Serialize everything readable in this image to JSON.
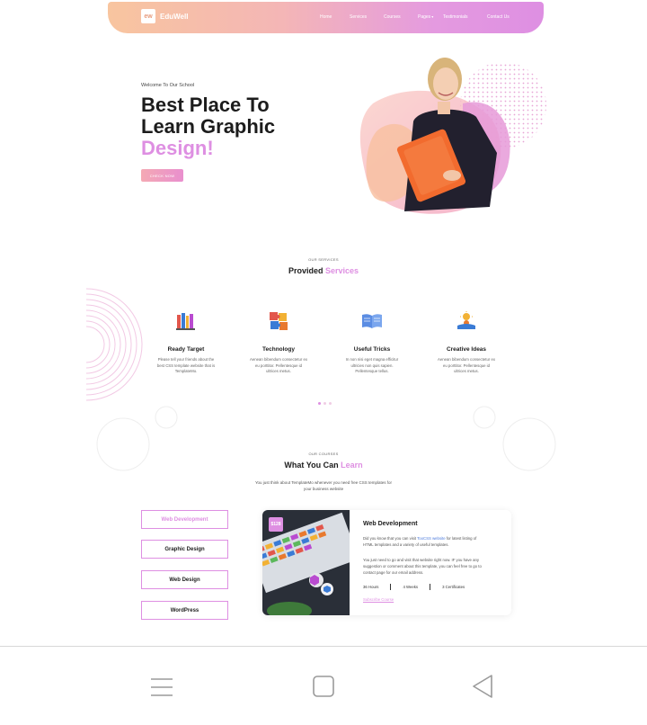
{
  "header": {
    "logo_mark": "ew",
    "logo_text": "EduWell",
    "nav": [
      "Home",
      "Services",
      "Courses",
      "Pages",
      "Testimonials",
      "Contact Us"
    ]
  },
  "hero": {
    "welcome": "Welcome To Our School",
    "title_line1": "Best Place To",
    "title_line2": "Learn Graphic",
    "title_accent": "Design!",
    "button": "CHECK NOW"
  },
  "services": {
    "kicker": "OUR SERVICES",
    "title_plain": "Provided ",
    "title_accent": "Services",
    "items": [
      {
        "icon": "books-icon",
        "title": "Ready Target",
        "lines": [
          "Please tell your friends about the",
          "best CSS template website that is",
          "TemplateMo."
        ]
      },
      {
        "icon": "puzzle-icon",
        "title": "Technology",
        "lines": [
          "Aenean bibendum consectetur ex",
          "eu porttitor. Pellentesque id",
          "ultrices metus."
        ]
      },
      {
        "icon": "open-book-icon",
        "title": "Useful Tricks",
        "lines": [
          "In non nisi eget magna efficitur",
          "ultricies non quis sapien.",
          "Pellentesque tellus."
        ]
      },
      {
        "icon": "reading-idea-icon",
        "title": "Creative Ideas",
        "lines": [
          "Aenean bibendum consectetur ex",
          "eu porttitor. Pellentesque id",
          "ultrices metus."
        ]
      }
    ],
    "carousel_active": 0
  },
  "courses": {
    "kicker": "OUR COURSES",
    "title_plain": "What You Can ",
    "title_accent": "Learn",
    "desc_line1": "You just think about TemplateMo whenever you need free CSS templates for",
    "desc_line2": "your business website",
    "tabs": [
      "Web Development",
      "Graphic Design",
      "Web Design",
      "WordPress"
    ],
    "active_tab": 0,
    "card": {
      "price": "$128",
      "title": "Web Development",
      "p1_a": "Did you know that you can visit ",
      "p1_link": "TooCSS website",
      "p1_b": " for latest listing of",
      "p1_line2": "HTML templates and a variety of useful templates.",
      "p2_line1": "You just need to go and visit that website right now. IF you have any",
      "p2_line2": "suggestion or comment about this template, you can feel free to go to",
      "p2_line3": "contact page for our email address.",
      "hours": "36 Hours",
      "weeks": "4 Weeks",
      "certs": "3 Certificates",
      "subscribe": "Subscribe Course"
    }
  },
  "colors": {
    "accent": "#de8fe2",
    "peach": "#f8c59f",
    "link": "#4d7bdc"
  }
}
